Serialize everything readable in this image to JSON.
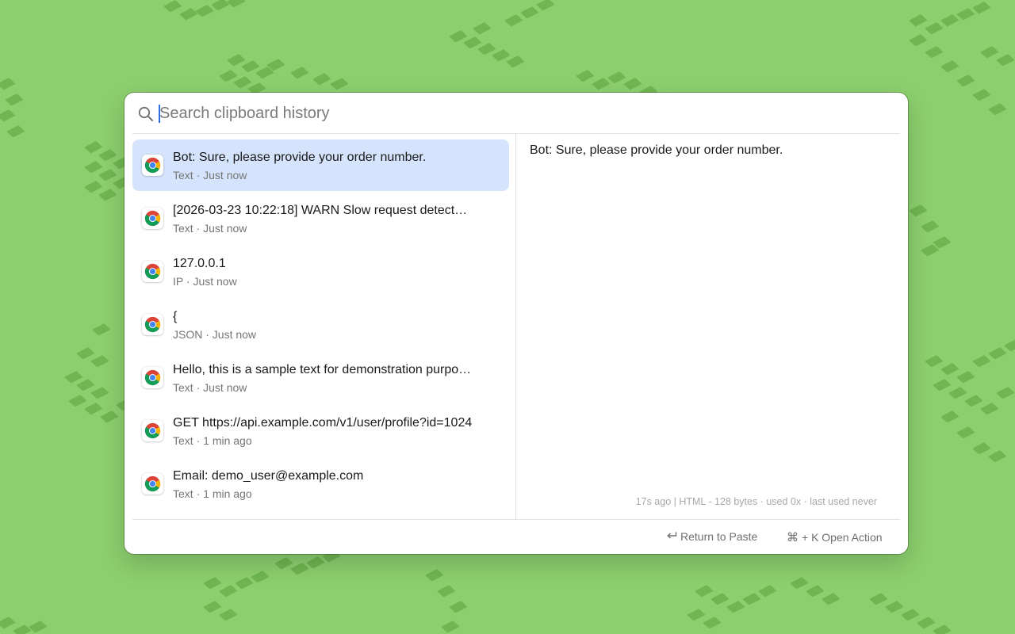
{
  "search": {
    "placeholder": "Search clipboard history",
    "value": ""
  },
  "items": [
    {
      "title": "Bot: Sure, please provide your order number.",
      "type": "Text",
      "time": "Just now",
      "selected": true,
      "app_icon": "chrome-icon"
    },
    {
      "title": "[2026-03-23 10:22:18] WARN  Slow request detect…",
      "type": "Text",
      "time": "Just now",
      "app_icon": "chrome-icon"
    },
    {
      "title": "127.0.0.1",
      "type": "IP",
      "time": "Just now",
      "app_icon": "chrome-icon"
    },
    {
      "title": "{",
      "type": "JSON",
      "time": "Just now",
      "app_icon": "chrome-icon"
    },
    {
      "title": "Hello, this is a sample text for demonstration purpo…",
      "type": "Text",
      "time": "Just now",
      "app_icon": "chrome-icon"
    },
    {
      "title": "GET https://api.example.com/v1/user/profile?id=1024",
      "type": "Text",
      "time": "1 min ago",
      "app_icon": "chrome-icon"
    },
    {
      "title": "Email: demo_user@example.com",
      "type": "Text",
      "time": "1 min ago",
      "app_icon": "chrome-icon"
    }
  ],
  "preview": {
    "text": "Bot: Sure, please provide your order number.",
    "meta": "17s ago | HTML - 128 bytes · used 0x · last used never"
  },
  "footer": {
    "paste_label": "Return to Paste",
    "paste_icon": "return-arrow-icon",
    "action_label": "+ K Open Action",
    "action_icon": "command-icon"
  },
  "colors": {
    "background": "#8ccf6e",
    "pixel_pattern": "#6fb651",
    "selection": "#d5e4fc",
    "caret": "#2f6fe4"
  }
}
